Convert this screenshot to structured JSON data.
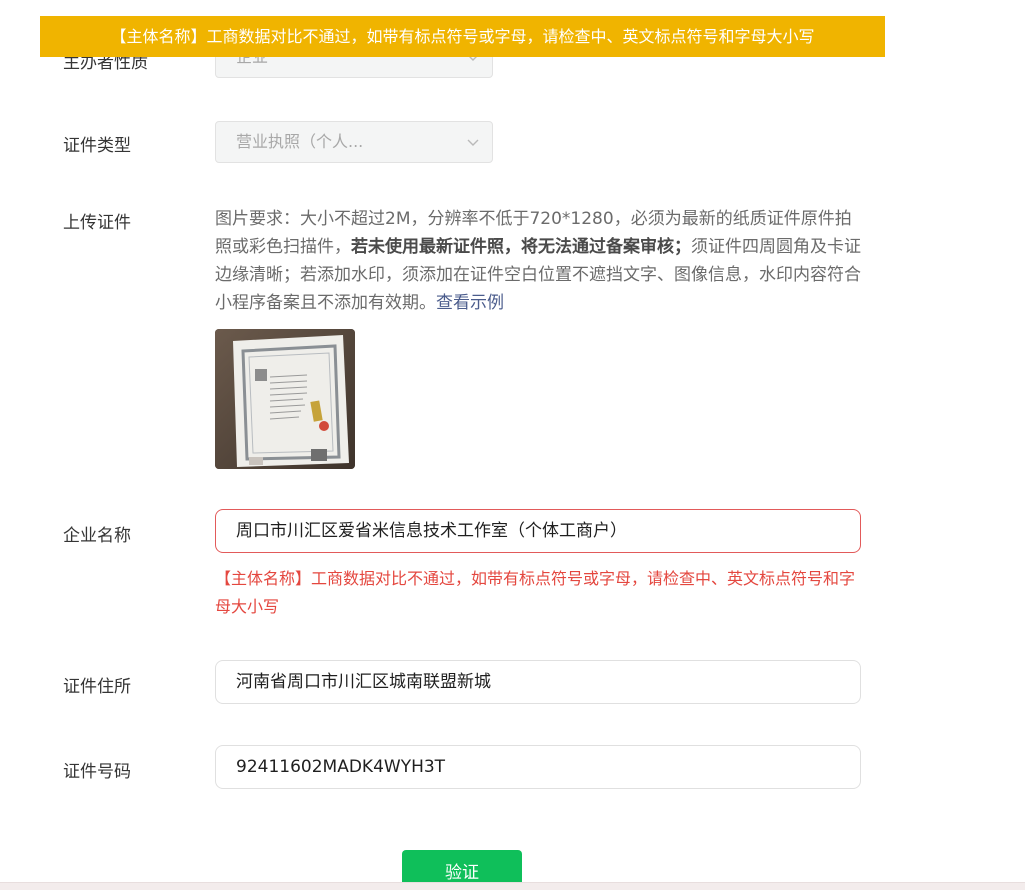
{
  "toast": {
    "message": "【主体名称】工商数据对比不通过，如带有标点符号或字母，请检查中、英文标点符号和字母大小写"
  },
  "form": {
    "subject_nature": {
      "label": "主办者性质",
      "value": "企业"
    },
    "cert_type": {
      "label": "证件类型",
      "value": "营业执照（个人..."
    },
    "upload": {
      "label": "上传证件",
      "desc_part1": "图片要求：大小不超过2M，分辨率不低于720*1280，必须为最新的纸质证件原件拍照或彩色扫描件，",
      "desc_bold": "若未使用最新证件照，将无法通过备案审核；",
      "desc_part2": "须证件四周圆角及卡证边缘清晰；若添加水印，须添加在证件空白位置不遮挡文字、图像信息，水印内容符合小程序备案且不添加有效期。",
      "example_link": "查看示例"
    },
    "company_name": {
      "label": "企业名称",
      "value": "周口市川汇区爱省米信息技术工作室（个体工商户）",
      "error": "【主体名称】工商数据对比不通过，如带有标点符号或字母，请检查中、英文标点符号和字母大小写"
    },
    "address": {
      "label": "证件住所",
      "value": "河南省周口市川汇区城南联盟新城"
    },
    "cert_number": {
      "label": "证件号码",
      "value": "92411602MADK4WYH3T"
    },
    "verify_button": "验证"
  },
  "colors": {
    "toast_bg": "#f0b400",
    "error": "#e4473f",
    "primary": "#0fbf5a"
  },
  "icons": {
    "select_chevron": "chevron-down-icon"
  }
}
